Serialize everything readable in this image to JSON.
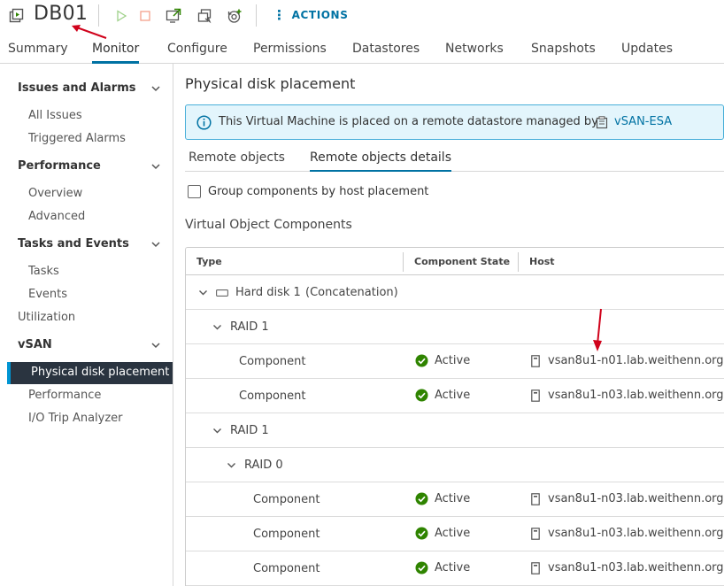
{
  "header": {
    "title": "DB01",
    "actions_label": "ACTIONS",
    "toolbar_icons": [
      "power-on-icon",
      "power-off-icon",
      "launch-console-icon",
      "migrate-icon",
      "snapshot-icon"
    ]
  },
  "tabs": [
    {
      "label": "Summary",
      "active": false
    },
    {
      "label": "Monitor",
      "active": true
    },
    {
      "label": "Configure",
      "active": false
    },
    {
      "label": "Permissions",
      "active": false
    },
    {
      "label": "Datastores",
      "active": false
    },
    {
      "label": "Networks",
      "active": false
    },
    {
      "label": "Snapshots",
      "active": false
    },
    {
      "label": "Updates",
      "active": false
    }
  ],
  "sidebar": {
    "groups": [
      {
        "label": "Issues and Alarms",
        "items": [
          "All Issues",
          "Triggered Alarms"
        ]
      },
      {
        "label": "Performance",
        "items": [
          "Overview",
          "Advanced"
        ]
      },
      {
        "label": "Tasks and Events",
        "items": [
          "Tasks",
          "Events"
        ]
      },
      {
        "label": "Utilization"
      },
      {
        "label": "vSAN",
        "items": [
          "Physical disk placement",
          "Performance",
          "I/O Trip Analyzer"
        ]
      }
    ],
    "active_item": "Physical disk placement"
  },
  "main": {
    "title": "Physical disk placement",
    "banner": {
      "text": "This Virtual Machine is placed on a remote datastore managed by",
      "link": "vSAN-ESA"
    },
    "subtabs": [
      {
        "label": "Remote objects",
        "active": false
      },
      {
        "label": "Remote objects details",
        "active": true
      }
    ],
    "checkbox_label": "Group components by host placement",
    "section_title": "Virtual Object Components",
    "table": {
      "columns": [
        "Type",
        "Component State",
        "Host"
      ],
      "rows": [
        {
          "type": "Hard disk 1",
          "detail": "(Concatenation)"
        },
        {
          "type": "RAID 1"
        },
        {
          "type": "Component",
          "state": "Active",
          "host": "vsan8u1-n01.lab.weithenn.org"
        },
        {
          "type": "Component",
          "state": "Active",
          "host": "vsan8u1-n03.lab.weithenn.org"
        },
        {
          "type": "RAID 1"
        },
        {
          "type": "RAID 0"
        },
        {
          "type": "Component",
          "state": "Active",
          "host": "vsan8u1-n03.lab.weithenn.org"
        },
        {
          "type": "Component",
          "state": "Active",
          "host": "vsan8u1-n03.lab.weithenn.org"
        },
        {
          "type": "Component",
          "state": "Active",
          "host": "vsan8u1-n03.lab.weithenn.org"
        }
      ]
    }
  },
  "colors": {
    "accent": "#0072a3",
    "annotation_arrow": "#d0021b",
    "active_state": "#2f8400",
    "sidebar_active_bg": "#2a3440"
  }
}
